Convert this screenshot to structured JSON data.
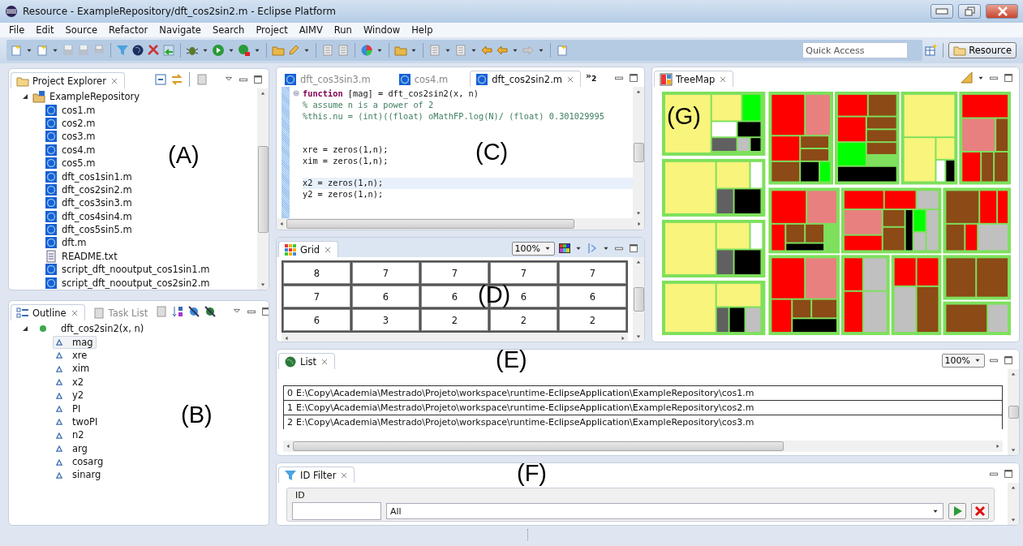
{
  "window": {
    "title": "Resource - ExampleRepository/dft_cos2sin2.m - Eclipse Platform"
  },
  "menu": [
    "File",
    "Edit",
    "Source",
    "Refactor",
    "Navigate",
    "Search",
    "Project",
    "AIMV",
    "Run",
    "Window",
    "Help"
  ],
  "toolbar": {
    "quick_access": {
      "placeholder": "Quick Access"
    },
    "perspective": {
      "label": "Resource",
      "selected": true
    }
  },
  "project_explorer": {
    "title": "Project Explorer",
    "annotation": "(A)",
    "root": {
      "label": "ExampleRepository",
      "expanded": true,
      "children": [
        {
          "label": "cos1.m",
          "kind": "m"
        },
        {
          "label": "cos2.m",
          "kind": "m"
        },
        {
          "label": "cos3.m",
          "kind": "m"
        },
        {
          "label": "cos4.m",
          "kind": "m"
        },
        {
          "label": "cos5.m",
          "kind": "m"
        },
        {
          "label": "dft_cos1sin1.m",
          "kind": "m"
        },
        {
          "label": "dft_cos2sin2.m",
          "kind": "m"
        },
        {
          "label": "dft_cos3sin3.m",
          "kind": "m"
        },
        {
          "label": "dft_cos4sin4.m",
          "kind": "m"
        },
        {
          "label": "dft_cos5sin5.m",
          "kind": "m"
        },
        {
          "label": "dft.m",
          "kind": "m"
        },
        {
          "label": "README.txt",
          "kind": "txt"
        },
        {
          "label": "script_dft_nooutput_cos1sin1.m",
          "kind": "m"
        },
        {
          "label": "script_dft_nooutput_cos2sin2.m",
          "kind": "m"
        }
      ]
    }
  },
  "outline": {
    "annotation": "(B)",
    "tabs": [
      {
        "label": "Outline",
        "selected": true
      },
      {
        "label": "Task List",
        "selected": false
      }
    ],
    "root": {
      "label": "dft_cos2sin2(x, n)",
      "expanded": true,
      "children": [
        {
          "label": "mag",
          "selected": true
        },
        {
          "label": "xre",
          "selected": false
        },
        {
          "label": "xim",
          "selected": false
        },
        {
          "label": "x2",
          "selected": false
        },
        {
          "label": "y2",
          "selected": false
        },
        {
          "label": "PI",
          "selected": false
        },
        {
          "label": "twoPI",
          "selected": false
        },
        {
          "label": "n2",
          "selected": false
        },
        {
          "label": "arg",
          "selected": false
        },
        {
          "label": "cosarg",
          "selected": false
        },
        {
          "label": "sinarg",
          "selected": false
        }
      ]
    }
  },
  "editor": {
    "annotation": "(C)",
    "tabs": [
      {
        "label": "dft_cos3sin3.m",
        "selected": false
      },
      {
        "label": "cos4.m",
        "selected": false
      },
      {
        "label": "dft_cos2sin2.m",
        "selected": true
      }
    ],
    "overflow": "»$_{2}$",
    "lines": [
      {
        "kind": "code",
        "current": false,
        "segments": [
          {
            "text": "function",
            "kind": "keyword"
          },
          {
            "text": " [mag] = dft_cos2sin2(x, n)",
            "kind": "plain"
          }
        ]
      },
      {
        "kind": "code",
        "current": false,
        "segments": [
          {
            "text": "% assume n is a power of 2",
            "kind": "comment"
          }
        ]
      },
      {
        "kind": "code",
        "current": false,
        "segments": [
          {
            "text": "%this.nu = (int)((float) oMathFP.log(N)/ (float) 0.301029995",
            "kind": "comment"
          }
        ]
      },
      {
        "kind": "blank"
      },
      {
        "kind": "blank"
      },
      {
        "kind": "code",
        "current": false,
        "segments": [
          {
            "text": "xre = zeros(1,n);",
            "kind": "plain"
          }
        ]
      },
      {
        "kind": "code",
        "current": false,
        "segments": [
          {
            "text": "xim = zeros(1,n);",
            "kind": "plain"
          }
        ]
      },
      {
        "kind": "blank"
      },
      {
        "kind": "code",
        "current": true,
        "segments": [
          {
            "text": "x2 = zeros(1,n);",
            "kind": "plain"
          }
        ]
      },
      {
        "kind": "code",
        "current": false,
        "segments": [
          {
            "text": "y2 = zeros(1,n);",
            "kind": "plain"
          }
        ]
      }
    ]
  },
  "grid": {
    "title": "Grid",
    "annotation": "(D)",
    "zoom": "100%",
    "rows": [
      [
        "8",
        "7",
        "7",
        "7",
        "7"
      ],
      [
        "7",
        "6",
        "6",
        "6",
        "6"
      ],
      [
        "6",
        "3",
        "2",
        "2",
        "2"
      ]
    ]
  },
  "treemap": {
    "title": "TreeMap",
    "annotation": "(G)"
  },
  "list": {
    "title": "List",
    "annotation": "(E)",
    "zoom": "100%",
    "rows": [
      {
        "index": "0",
        "path": "E:\\Copy\\Academia\\Mestrado\\Projeto\\workspace\\runtime-EclipseApplication\\ExampleRepository\\cos1.m"
      },
      {
        "index": "1",
        "path": "E:\\Copy\\Academia\\Mestrado\\Projeto\\workspace\\runtime-EclipseApplication\\ExampleRepository\\cos2.m"
      },
      {
        "index": "2",
        "path": "E:\\Copy\\Academia\\Mestrado\\Projeto\\workspace\\runtime-EclipseApplication\\ExampleRepository\\cos3.m"
      }
    ]
  },
  "id_filter": {
    "title": "ID Filter",
    "annotation": "(F)",
    "label": "ID",
    "select_value": "All"
  }
}
